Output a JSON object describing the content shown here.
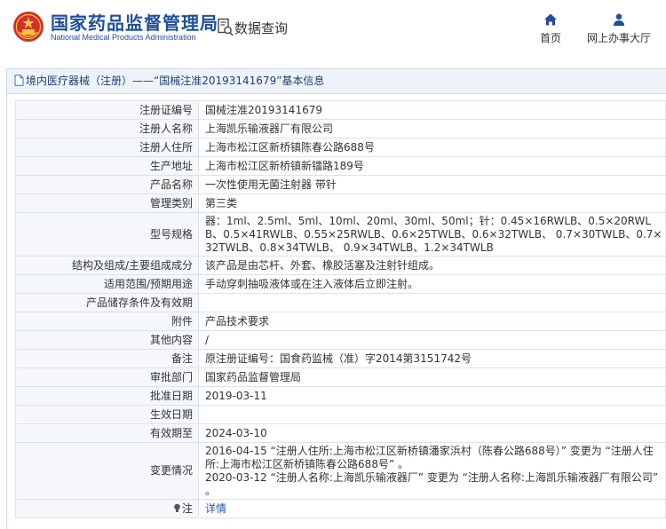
{
  "header": {
    "title_cn": "国家药品监督管理局",
    "title_en": "National Medical Products Administration",
    "query_label": "数据查询",
    "nav": {
      "home": "首页",
      "office": "网上办事大厅"
    }
  },
  "panel": {
    "title": "境内医疗器械（注册）——“国械注准20193141679”基本信息"
  },
  "rows": [
    {
      "label": "注册证编号",
      "value": "国械注准20193141679"
    },
    {
      "label": "注册人名称",
      "value": "上海凯乐输液器厂有限公司"
    },
    {
      "label": "注册人住所",
      "value": "上海市松江区新桥镇陈春公路688号"
    },
    {
      "label": "生产地址",
      "value": "上海市松江区新桥镇新镭路189号"
    },
    {
      "label": "产品名称",
      "value": "一次性使用无菌注射器 带针"
    },
    {
      "label": "管理类别",
      "value": "第三类"
    },
    {
      "label": "型号规格",
      "value": "器：1ml、2.5ml、5ml、10ml、20ml、30ml、50ml；针：0.45×16RWLB、0.5×20RWLB、0.5×41RWLB、0.55×25RWLB、0.6×25TWLB、0.6×32TWLB、 0.7×30TWLB、0.7×32TWLB、0.8×34TWLB、 0.9×34TWLB、1.2×34TWLB"
    },
    {
      "label": "结构及组成/主要组成成分",
      "value": "该产品是由芯杆、外套、橡胶活塞及注射针组成。"
    },
    {
      "label": "适用范围/预期用途",
      "value": "手动穿刺抽吸液体或在注入液体后立即注射。"
    },
    {
      "label": "产品储存条件及有效期",
      "value": ""
    },
    {
      "label": "附件",
      "value": "产品技术要求"
    },
    {
      "label": "其他内容",
      "value": "/"
    },
    {
      "label": "备注",
      "value": "原注册证编号：国食药监械（准）字2014第3151742号"
    },
    {
      "label": "审批部门",
      "value": "国家药品监督管理局"
    },
    {
      "label": "批准日期",
      "value": "2019-03-11"
    },
    {
      "label": "生效日期",
      "value": ""
    },
    {
      "label": "有效期至",
      "value": "2024-03-10"
    }
  ],
  "change": {
    "label": "变更情况",
    "line1": "2016-04-15 “注册人住所:上海市松江区新桥镇潘家浜村（陈春公路688号）” 变更为 “注册人住所:上海市松江区新桥镇陈春公路688号” 。",
    "line2": "2020-03-12 “注册人名称:上海凯乐输液器厂” 变更为 “注册人名称:上海凯乐输液器厂有限公司” 。"
  },
  "note": {
    "label": "注",
    "link": "详情"
  },
  "colors": {
    "brand_blue": "#1f4f9a",
    "emblem_red": "#d0312d",
    "link_blue": "#1f5aa8",
    "label_bg": "#f5f7fa",
    "title_bg": "#eef3f9"
  }
}
